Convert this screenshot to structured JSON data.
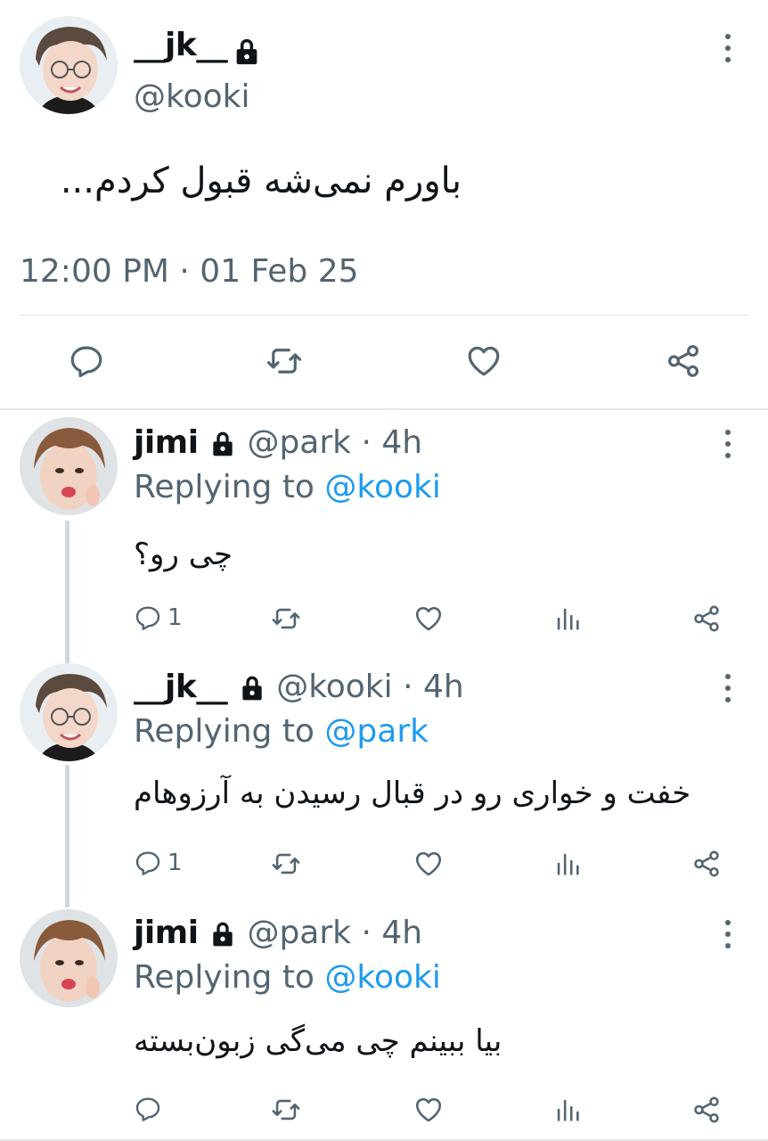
{
  "main_tweet": {
    "display_name": "__jk__",
    "handle": "@kooki",
    "text": "باورم نمی‌شه قبول کردم...",
    "timestamp": "12:00 PM · 01 Feb 25",
    "actions": [
      "reply-icon",
      "retweet-icon",
      "like-icon",
      "share-icon"
    ]
  },
  "replies": [
    {
      "display_name": "jimi",
      "handle": "@park",
      "sep": "·",
      "time": "4h",
      "replying_prefix": "Replying to",
      "replying_to": "@kooki",
      "text": "چی رو؟",
      "reply_count": "1"
    },
    {
      "display_name": "__jk__",
      "handle": "@kooki",
      "sep": "·",
      "time": "4h",
      "replying_prefix": "Replying to",
      "replying_to": "@park",
      "text": "خفت و خواری رو در قبال رسیدن به آرزوهام",
      "reply_count": "1"
    },
    {
      "display_name": "jimi",
      "handle": "@park",
      "sep": "·",
      "time": "4h",
      "replying_prefix": "Replying to",
      "replying_to": "@kooki",
      "text": "بیا ببینم چی می‌گی زبون‌بسته",
      "reply_count": ""
    }
  ],
  "colors": {
    "accent": "#1d9bf0",
    "muted": "#536471",
    "divider": "#e3e8eb"
  }
}
